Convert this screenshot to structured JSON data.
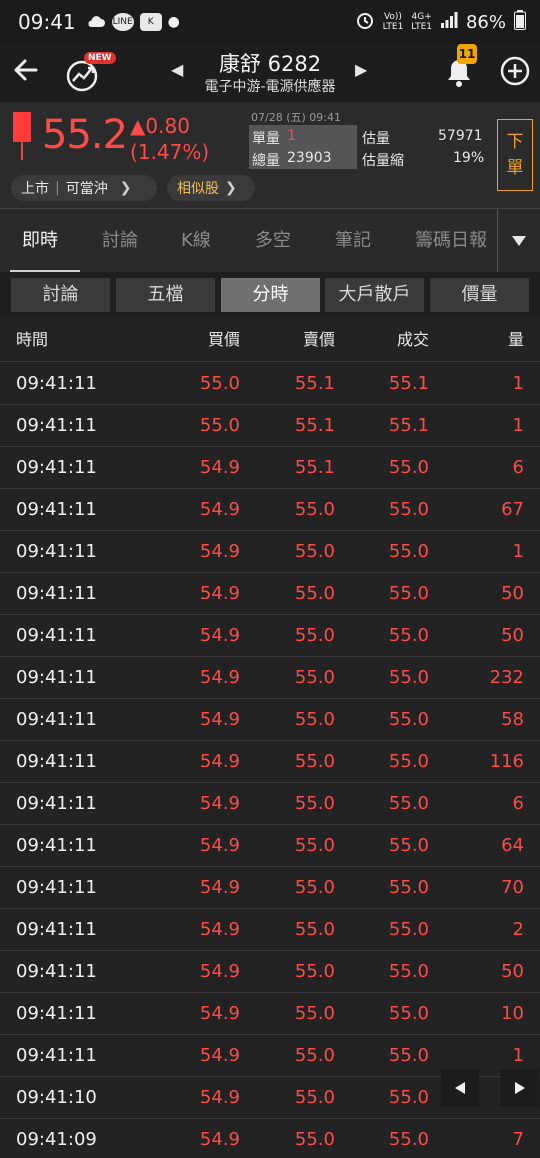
{
  "status_bar": {
    "time": "09:41",
    "battery": "86%",
    "net_top": "Vo))",
    "net_bottom": "LTE1",
    "net2_top": "4G+",
    "net2_bottom": "LTE1"
  },
  "header": {
    "new_badge": "NEW",
    "title": "康舒 6282",
    "subtitle": "電子中游-電源供應器",
    "notification_count": "11"
  },
  "quote": {
    "price": "55.2",
    "change": "▲0.80",
    "change_pct": "(1.47%)",
    "datetime": "07/28 (五) 09:41",
    "single_vol_label": "單量",
    "single_vol": "1",
    "total_vol_label": "總量",
    "total_vol": "23903",
    "est_vol_label": "估量",
    "est_vol": "57971",
    "est_shrink_label": "估量縮",
    "est_shrink": "19%",
    "order_label_1": "下",
    "order_label_2": "單",
    "market_label": "上市",
    "daytrade_label": "可當沖",
    "similar_label": "相似股"
  },
  "tabs": [
    "即時",
    "討論",
    "K線",
    "多空",
    "筆記",
    "籌碼日報"
  ],
  "subtabs": [
    "討論",
    "五檔",
    "分時",
    "大戶散戶",
    "價量"
  ],
  "table": {
    "headers": [
      "時間",
      "買價",
      "賣價",
      "成交",
      "量"
    ],
    "rows": [
      [
        "09:41:11",
        "55.0",
        "55.1",
        "55.1",
        "1"
      ],
      [
        "09:41:11",
        "55.0",
        "55.1",
        "55.1",
        "1"
      ],
      [
        "09:41:11",
        "54.9",
        "55.1",
        "55.0",
        "6"
      ],
      [
        "09:41:11",
        "54.9",
        "55.0",
        "55.0",
        "67"
      ],
      [
        "09:41:11",
        "54.9",
        "55.0",
        "55.0",
        "1"
      ],
      [
        "09:41:11",
        "54.9",
        "55.0",
        "55.0",
        "50"
      ],
      [
        "09:41:11",
        "54.9",
        "55.0",
        "55.0",
        "50"
      ],
      [
        "09:41:11",
        "54.9",
        "55.0",
        "55.0",
        "232"
      ],
      [
        "09:41:11",
        "54.9",
        "55.0",
        "55.0",
        "58"
      ],
      [
        "09:41:11",
        "54.9",
        "55.0",
        "55.0",
        "116"
      ],
      [
        "09:41:11",
        "54.9",
        "55.0",
        "55.0",
        "6"
      ],
      [
        "09:41:11",
        "54.9",
        "55.0",
        "55.0",
        "64"
      ],
      [
        "09:41:11",
        "54.9",
        "55.0",
        "55.0",
        "70"
      ],
      [
        "09:41:11",
        "54.9",
        "55.0",
        "55.0",
        "2"
      ],
      [
        "09:41:11",
        "54.9",
        "55.0",
        "55.0",
        "50"
      ],
      [
        "09:41:11",
        "54.9",
        "55.0",
        "55.0",
        "10"
      ],
      [
        "09:41:11",
        "54.9",
        "55.0",
        "55.0",
        "1"
      ],
      [
        "09:41:10",
        "54.9",
        "55.0",
        "55.0",
        "1"
      ],
      [
        "09:41:09",
        "54.9",
        "55.0",
        "55.0",
        "7"
      ]
    ]
  },
  "colors": {
    "up": "#ff4a4a",
    "accent": "#f0a020"
  }
}
